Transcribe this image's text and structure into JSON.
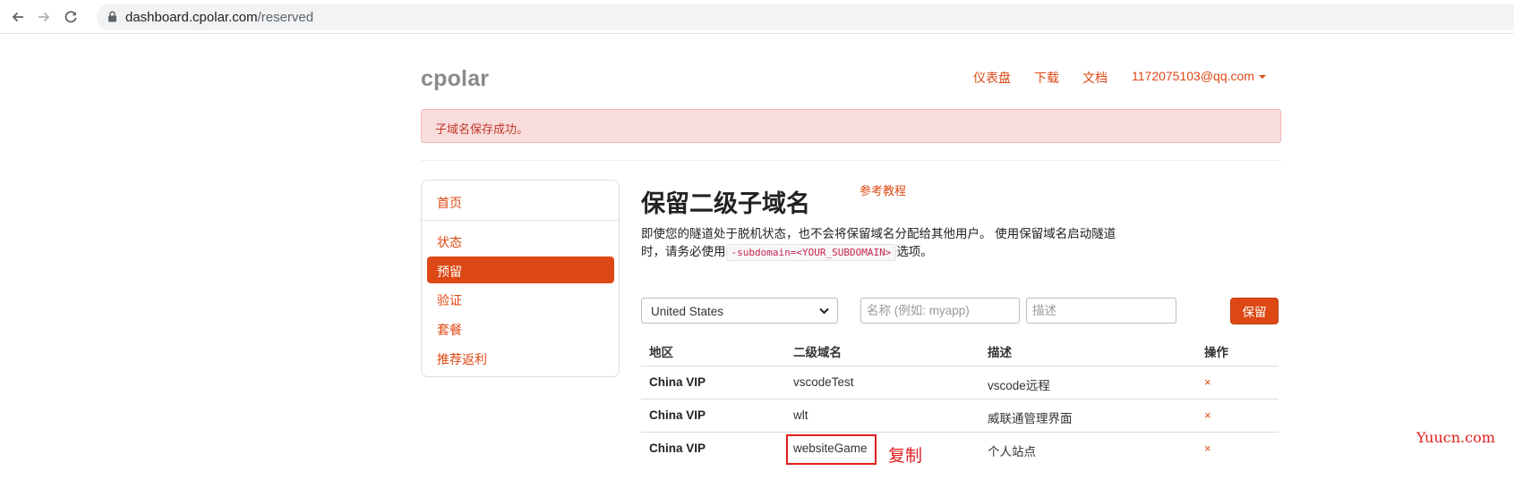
{
  "browser": {
    "url_host": "dashboard.cpolar.com",
    "url_path": "/reserved"
  },
  "header": {
    "brand": "cpolar",
    "nav": {
      "dashboard": "仪表盘",
      "download": "下载",
      "docs": "文档",
      "user": "1172075103@qq.com"
    }
  },
  "alert": {
    "message": "子域名保存成功。"
  },
  "sidebar": {
    "items": [
      "首页",
      "状态",
      "预留",
      "验证",
      "套餐",
      "推荐返利"
    ],
    "active": "预留"
  },
  "main": {
    "title": "保留二级子域名",
    "ref_link": "参考教程",
    "desc_line1": "即使您的隧道处于脱机状态，也不会将保留域名分配给其他用户。 使用保留域名启动隧道",
    "desc_line2_pre": "时，请务必使用",
    "desc_code": "-subdomain=<YOUR_SUBDOMAIN>",
    "desc_line2_post": "选项。"
  },
  "form": {
    "region_selected": "United States",
    "name_placeholder": "名称 (例如: myapp)",
    "desc_placeholder": "描述",
    "save_label": "保留"
  },
  "table": {
    "headers": {
      "region": "地区",
      "subdomain": "二级域名",
      "description": "描述",
      "action": "操作"
    },
    "rows": [
      {
        "region": "China VIP",
        "subdomain": "vscodeTest",
        "description": "vscode远程",
        "action": "×"
      },
      {
        "region": "China VIP",
        "subdomain": "wlt",
        "description": "威联通管理界面",
        "action": "×"
      },
      {
        "region": "China VIP",
        "subdomain": "websiteGame",
        "description": "个人站点",
        "action": "×"
      }
    ]
  },
  "annotation": {
    "text": "复制",
    "color": "#e01d1d"
  },
  "watermark": "Yuucn.com",
  "colors": {
    "accent": "#dd4814",
    "alert_bg": "#f9dcdc"
  }
}
